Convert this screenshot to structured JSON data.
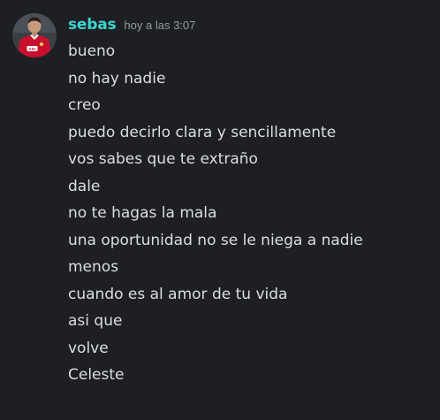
{
  "message": {
    "username": "sebas",
    "timestamp": "hoy a las 3:07",
    "avatar_icon": "user-avatar-photo",
    "avatar_badge_text": "AIG",
    "username_color": "#3bd5cf",
    "lines": [
      "bueno",
      "no hay nadie",
      "creo",
      "puedo decirlo clara y sencillamente",
      "vos sabes que te extraño",
      "dale",
      "no te hagas la mala",
      "una oportunidad no se le niega a nadie",
      "menos",
      "cuando es al amor de tu vida",
      "asi que",
      "volve",
      "Celeste"
    ]
  }
}
